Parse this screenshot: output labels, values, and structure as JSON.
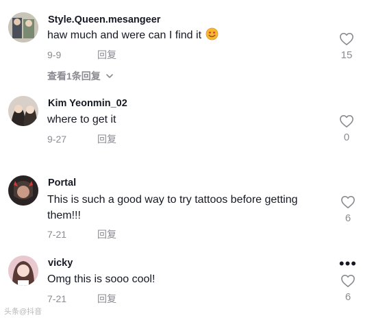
{
  "comments": [
    {
      "username": "Style.Queen.mesangeer",
      "text": "haw much and were can I find it",
      "emoji": "smiling-face-with-heart-eyes",
      "date": "9-9",
      "reply_label": "回复",
      "likes": "15",
      "view_replies": "查看1条回复"
    },
    {
      "username": "Kim Yeonmin_02",
      "text": "where to get it",
      "date": "9-27",
      "reply_label": "回复",
      "likes": "0"
    },
    {
      "username": "Portal",
      "text": "This is such a good way to try tattoos before getting them!!!",
      "date": "7-21",
      "reply_label": "回复",
      "likes": "6"
    },
    {
      "username": "vicky",
      "text": "Omg this is sooo cool!",
      "date": "7-21",
      "reply_label": "回复",
      "likes": "6",
      "more_icon": "more-horizontal-icon"
    }
  ],
  "watermark": "头条@抖音",
  "icons": {
    "like": "heart-outline-icon",
    "expand": "chevron-down-icon"
  },
  "colors": {
    "text": "#161823",
    "secondary": "#8a8b91"
  }
}
